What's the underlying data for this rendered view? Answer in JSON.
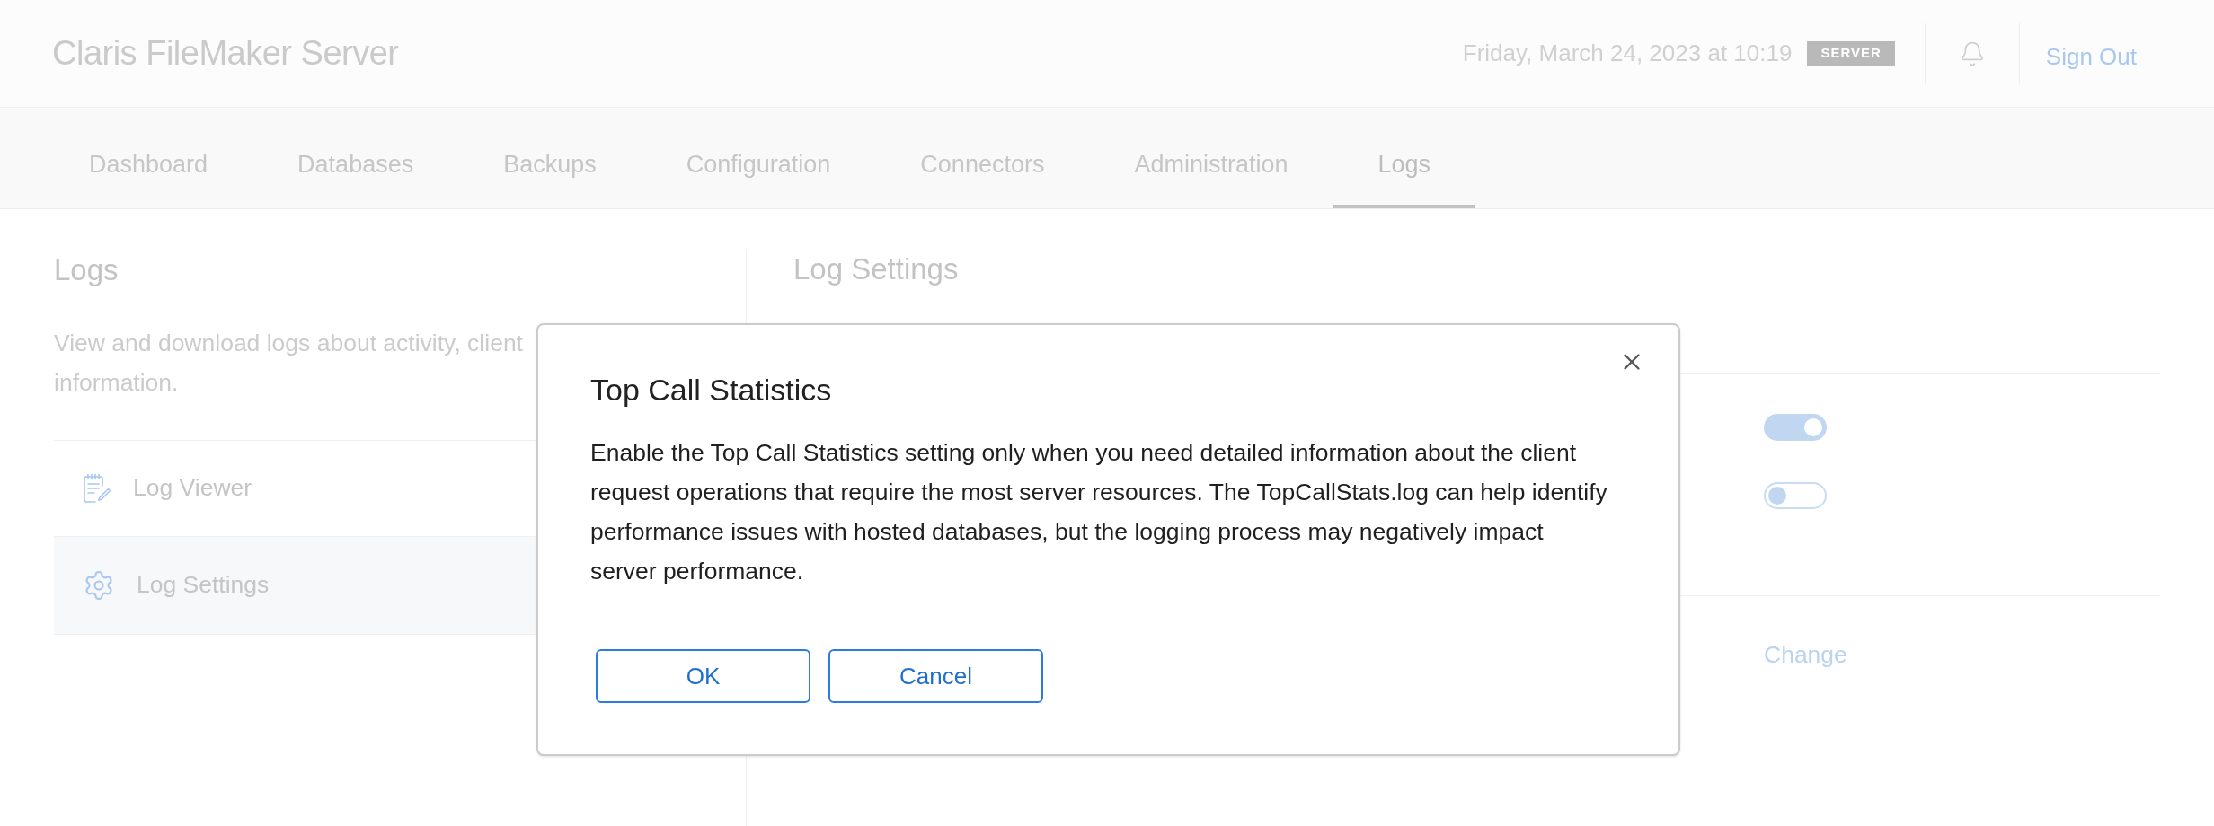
{
  "header": {
    "title": "Claris FileMaker Server",
    "datetime": "Friday, March 24, 2023 at 10:19",
    "badge": "SERVER",
    "sign_out": "Sign Out"
  },
  "tabs": [
    {
      "label": "Dashboard",
      "selected": false
    },
    {
      "label": "Databases",
      "selected": false
    },
    {
      "label": "Backups",
      "selected": false
    },
    {
      "label": "Configuration",
      "selected": false
    },
    {
      "label": "Connectors",
      "selected": false
    },
    {
      "label": "Administration",
      "selected": false
    },
    {
      "label": "Logs",
      "selected": true
    }
  ],
  "sidebar": {
    "title": "Logs",
    "description_lines": [
      "View and download logs about activity, client",
      "information."
    ],
    "items": [
      {
        "label": "Log Viewer",
        "kind": "viewer",
        "selected": false
      },
      {
        "label": "Log Settings",
        "kind": "settings",
        "selected": true
      }
    ]
  },
  "settings_panel": {
    "title": "Log Settings",
    "toggles": [
      {
        "on": true
      },
      {
        "on": false
      }
    ],
    "link": "Change"
  },
  "dialog": {
    "title": "Top Call Statistics",
    "body_lines": [
      "Enable the Top Call Statistics setting only when you need detailed information about the client",
      "request operations that require the most server resources. The TopCallStats.log can help identify",
      "performance issues with hosted databases, but the logging process may negatively impact",
      "server performance."
    ],
    "buttons": [
      "OK",
      "Cancel"
    ]
  }
}
